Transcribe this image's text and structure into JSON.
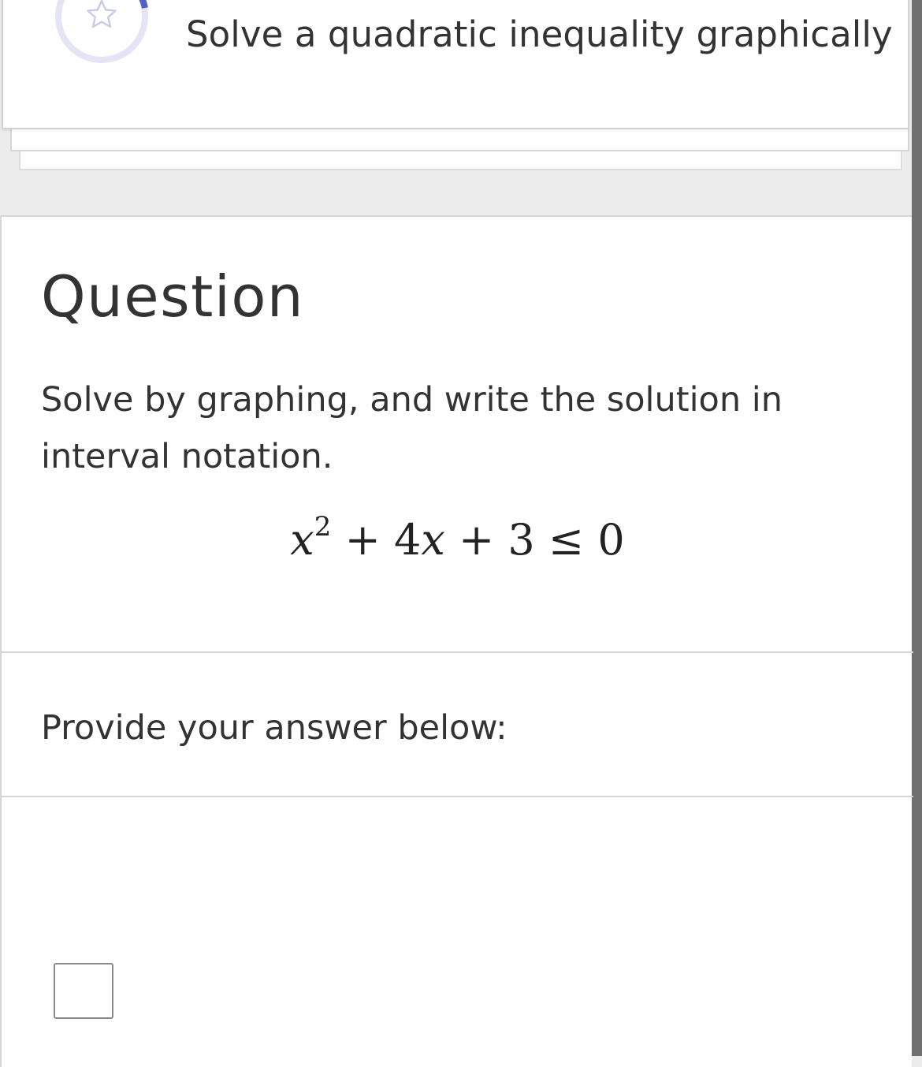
{
  "topic": {
    "title": "Solve a quadratic inequality graphically",
    "icon": "star-icon",
    "ring_color": "#e6e6f6",
    "ring_progress_color": "#5560c4"
  },
  "question": {
    "heading": "Question",
    "instruction": "Solve by graphing, and write the solution in interval notation.",
    "equation": {
      "base": "x",
      "exponent": "2",
      "middle": " + 4",
      "var2": "x",
      "tail": " + 3 ≤ 0"
    }
  },
  "answer": {
    "prompt": "Provide your answer below:",
    "value": ""
  }
}
